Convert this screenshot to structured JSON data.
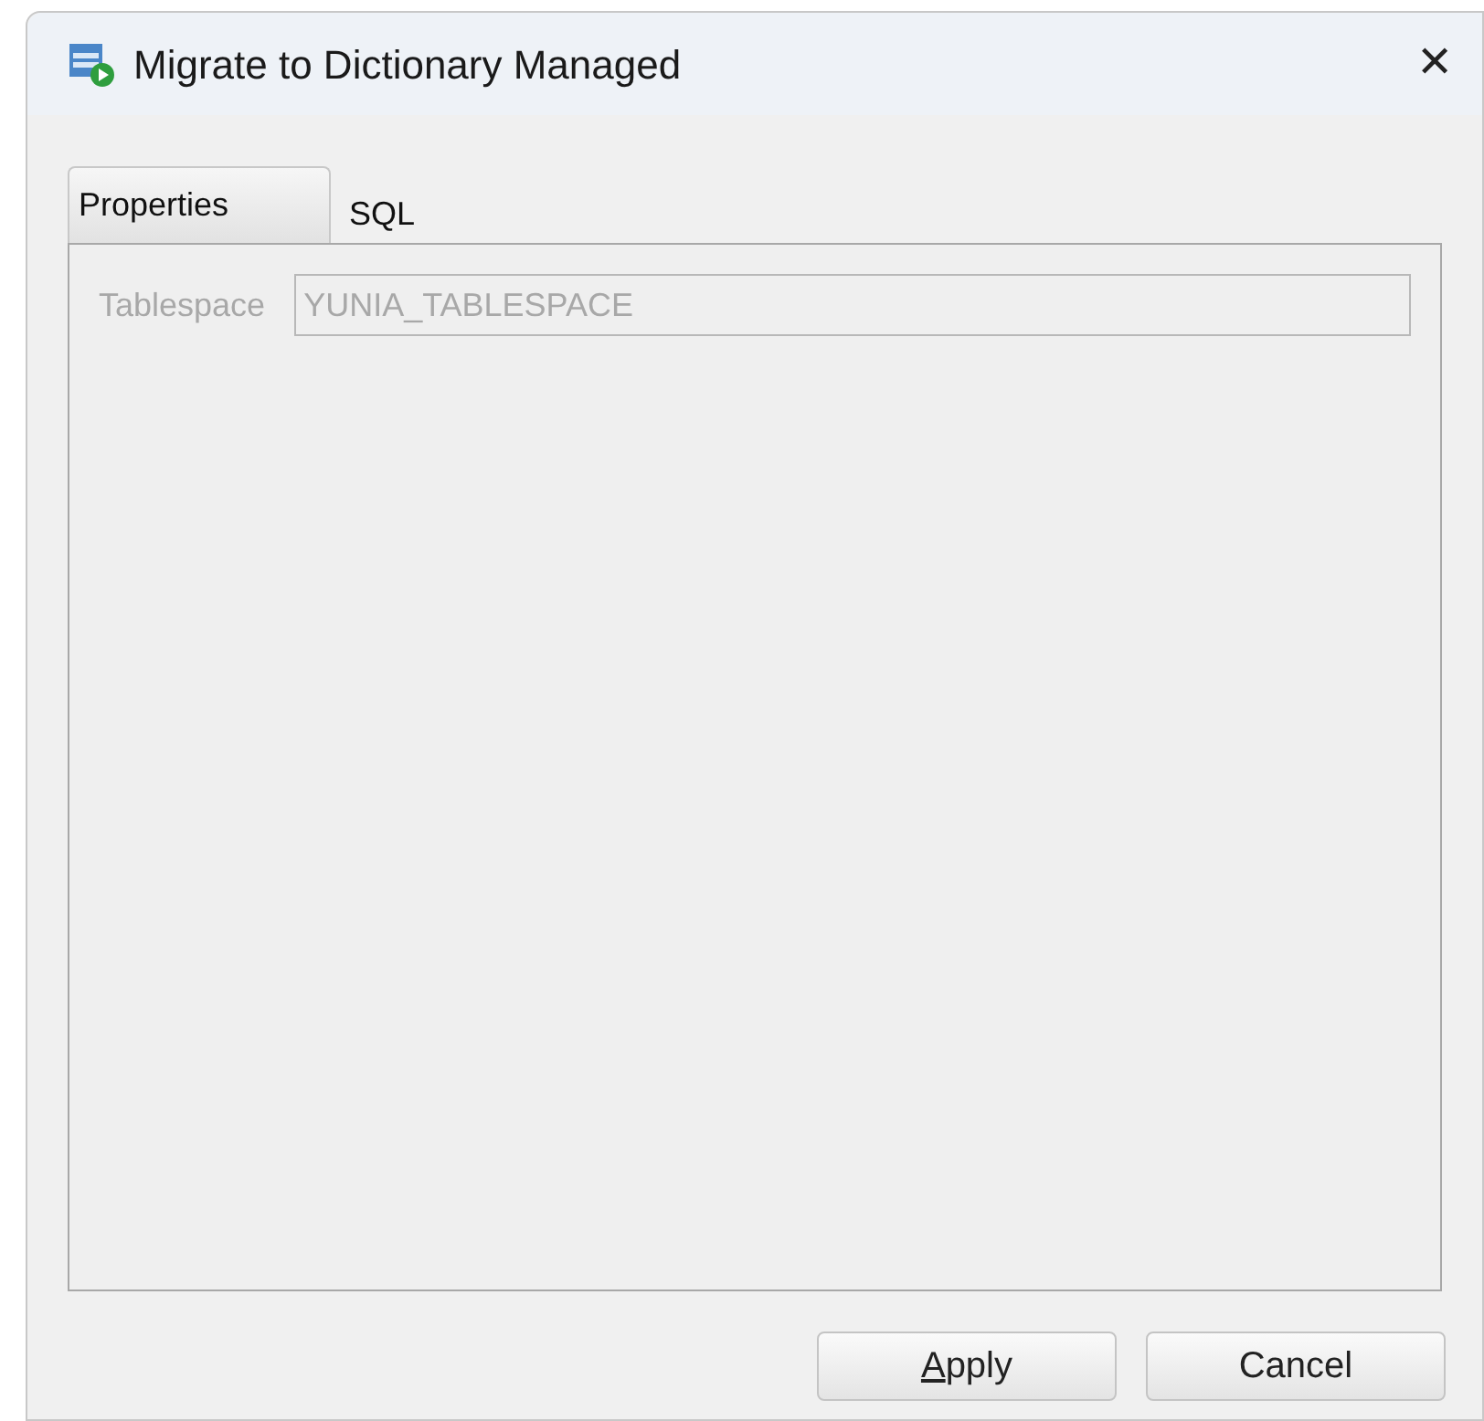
{
  "window": {
    "title": "Migrate to Dictionary Managed",
    "close": "✕"
  },
  "tabs": [
    {
      "label": "Properties",
      "selected": true
    },
    {
      "label": "SQL",
      "selected": false
    }
  ],
  "fields": [
    {
      "label": "Tablespace",
      "value": "YUNIA_TABLESPACE",
      "disabled": true
    }
  ],
  "buttons": [
    {
      "label": "Apply",
      "underline_first": true
    },
    {
      "label": "Cancel",
      "underline_first": false
    }
  ]
}
